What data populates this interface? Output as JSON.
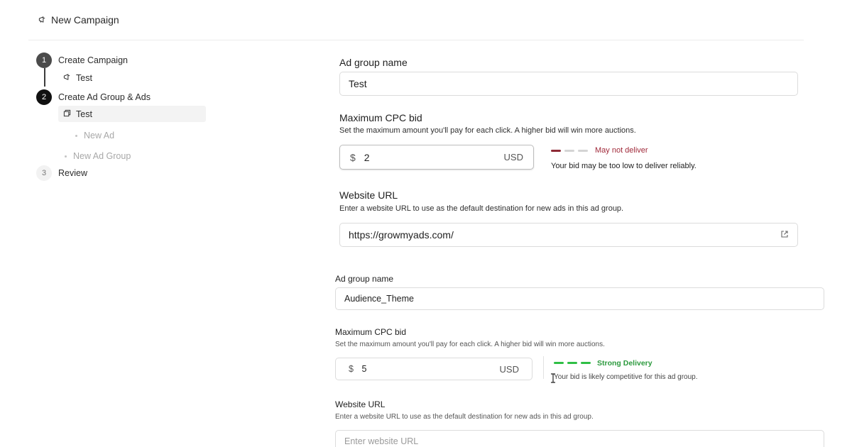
{
  "header": {
    "title": "New Campaign",
    "icon": "megaphone-icon"
  },
  "steps": [
    {
      "number": "1",
      "label": "Create Campaign"
    },
    {
      "number": "2",
      "label": "Create Ad Group & Ads"
    },
    {
      "number": "3",
      "label": "Review"
    }
  ],
  "campaign_sub": {
    "label": "Test",
    "icon": "megaphone-icon"
  },
  "adgroup_sub": {
    "label": "Test",
    "icon": "copy-icon"
  },
  "new_ad": "New Ad",
  "new_ad_group": "New Ad Group",
  "group1": {
    "name_label": "Ad group name",
    "name_value": "Test",
    "bid_label": "Maximum CPC bid",
    "bid_hint": "Set the maximum amount you'll pay for each click. A higher bid will win more auctions.",
    "currency_symbol": "$",
    "bid_value": "2",
    "currency_code": "USD",
    "status": "May not deliver",
    "status_message": "Your bid may be too low to deliver reliably.",
    "url_label": "Website URL",
    "url_hint": "Enter a website URL to use as the default destination for new ads in this ad group.",
    "url_value": "https://growmyads.com/"
  },
  "group2": {
    "name_label": "Ad group name",
    "name_value": "Audience_Theme",
    "bid_label": "Maximum CPC bid",
    "bid_hint": "Set the maximum amount you'll pay for each click. A higher bid will win more auctions.",
    "currency_symbol": "$",
    "bid_value": "5",
    "currency_code": "USD",
    "status": "Strong Delivery",
    "status_message": "Your bid is likely competitive for this ad group.",
    "url_label": "Website URL",
    "url_hint": "Enter a website URL to use as the default destination for new ads in this ad group.",
    "url_placeholder": "Enter website URL"
  },
  "colors": {
    "bar_red": "#8e2a36",
    "bar_gray": "#d4d4d4",
    "bar_green": "#2fbf45",
    "status_red": "#a02a3a",
    "status_green": "#2c9a3e"
  }
}
